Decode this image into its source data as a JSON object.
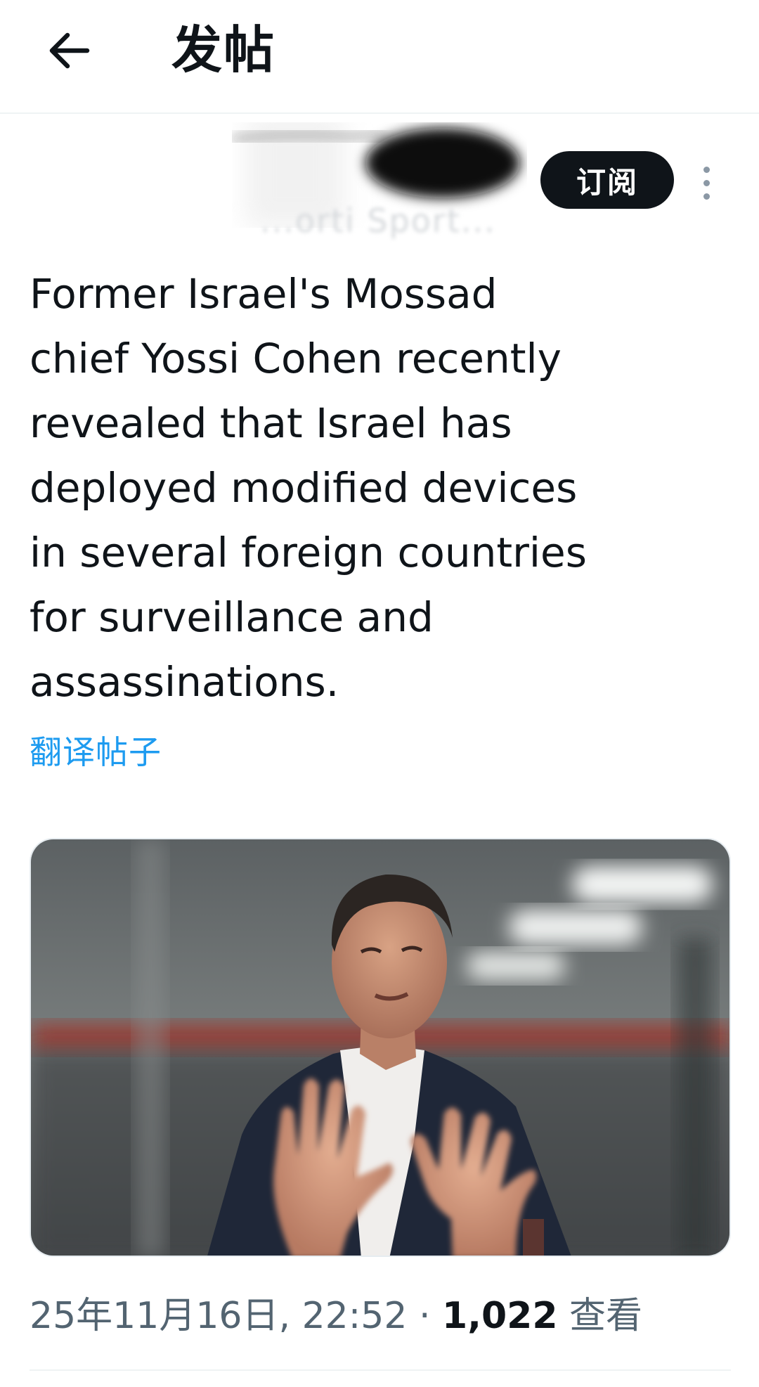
{
  "header": {
    "back_icon": "arrow-left-icon",
    "title": "发帖"
  },
  "author": {
    "name_partial": "...orti Sport...",
    "subscribe_label": "订阅",
    "more_icon": "more-vertical-icon"
  },
  "post": {
    "text": "Former Israel's Mossad\nchief Yossi Cohen recently\nrevealed that Israel has\ndeployed modified devices\nin several foreign countries\nfor surveillance and\nassassinations.",
    "translate_label": "翻译帖子"
  },
  "media": {
    "image_icon": "photo-man-gesturing"
  },
  "meta": {
    "timestamp": "25年11月16日, 22:52 · ",
    "views_count": "1,022",
    "views_label": " 查看"
  },
  "colors": {
    "accent": "#1d9bf0",
    "text": "#0f1419",
    "secondary": "#536471",
    "button_bg": "#0f1419"
  }
}
